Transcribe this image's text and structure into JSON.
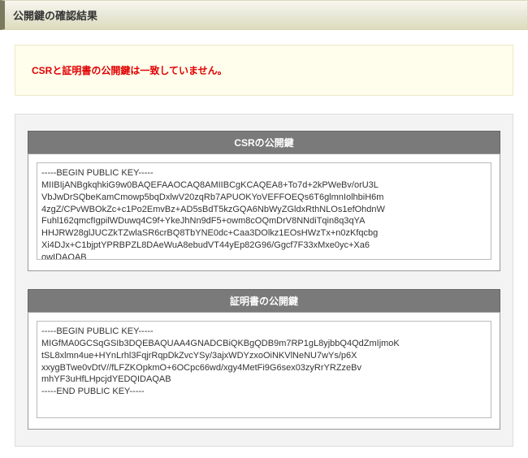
{
  "page": {
    "title": "公開鍵の確認結果"
  },
  "alert": {
    "message": "CSRと証明書の公開鍵は一致していません。"
  },
  "sections": {
    "csr": {
      "title": "CSRの公開鍵",
      "content": "-----BEGIN PUBLIC KEY-----\nMIIBIjANBgkqhkiG9w0BAQEFAAOCAQ8AMIIBCgKCAQEA8+To7d+2kPWeBv/orU3L\nVbJwDrSQbeKamCmowp5bqDxlwV20zqRb7APUOKYoVEFFOEQs6T6glmnIolhbiH6m\n4zgZ/CPvWBOkZc+c1Po2EmvBz+AD5sBdT5kzGQA6NbWyZGldxRthNLOs1efOhdnW\nFuhl162qmcfIgpilWDuwq4C9f+YkeJhNn9dF5+owm8cOQmDrV8NNdiTqin8q3qYA\nHHJRW28glJUCZkTZwlaSR6crBQ8TbYNE0dc+Caa3DOlkz1EOsHWzTx+n0zKfqcbg\nXi4DJx+C1bjptYPRBPZL8DAeWuA8ebudVT44yEp82G96/Ggcf7F33xMxe0yc+Xa6\nowIDAQAB\n-----END PUBLIC KEY-----"
    },
    "cert": {
      "title": "証明書の公開鍵",
      "content": "-----BEGIN PUBLIC KEY-----\nMIGfMA0GCSqGSIb3DQEBAQUAA4GNADCBiQKBgQDB9m7RP1gL8yjbbQ4QdZmIjmoK\ntSL8xlmn4ue+HYnLrhl3FqjrRqpDkZvcYSy/3ajxWDYzxoOiNKVlNeNU7wYs/p6X\nxxygBTwe0vDtV//fLFZKOpkmO+6OCpc66wd/xgy4MetFi9G6sex03zyRrYRZzeBv\nmhYF3uHfLHpcjdYEDQIDAQAB\n-----END PUBLIC KEY-----"
    }
  }
}
